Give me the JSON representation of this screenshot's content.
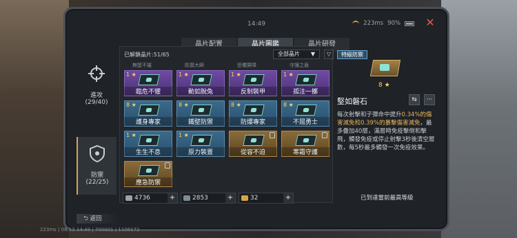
{
  "status": {
    "time": "14:49",
    "network": "223ms",
    "battery": "90%"
  },
  "tabs": [
    {
      "label": "晶片配置",
      "active": false
    },
    {
      "label": "晶片圖鑑",
      "active": true
    },
    {
      "label": "晶片研發",
      "active": false
    }
  ],
  "sidebar": {
    "attack": {
      "label": "進攻",
      "count": "(29/40)"
    },
    "defense": {
      "label": "防禦",
      "count": "(22/25)"
    }
  },
  "collection": {
    "unlocked": "已解鎖晶片:51/65",
    "filter": "全部晶片",
    "top_row": [
      "無堅不摧",
      "防禦大師",
      "恐懼屏障",
      "守護之盾"
    ],
    "cards": [
      {
        "level": "1",
        "name": "臨危不懼",
        "color": "purple",
        "locked": false
      },
      {
        "level": "1",
        "name": "動如脫兔",
        "color": "purple",
        "locked": false
      },
      {
        "level": "1",
        "name": "反制裝甲",
        "color": "purple",
        "locked": false
      },
      {
        "level": "1",
        "name": "孤注一擲",
        "color": "purple",
        "locked": false
      },
      {
        "level": "8",
        "name": "護身專家",
        "color": "blue",
        "locked": false
      },
      {
        "level": "8",
        "name": "鐵壁防禦",
        "color": "blue",
        "locked": false
      },
      {
        "level": "8",
        "name": "防爆專家",
        "color": "blue",
        "locked": false
      },
      {
        "level": "8",
        "name": "不屈勇士",
        "color": "blue",
        "locked": false
      },
      {
        "level": "1",
        "name": "生生不息",
        "color": "blue",
        "locked": false
      },
      {
        "level": "1",
        "name": "原力裝置",
        "color": "blue",
        "locked": false
      },
      {
        "level": "",
        "name": "從容不迫",
        "color": "gold",
        "locked": true
      },
      {
        "level": "",
        "name": "寒霜守護",
        "color": "gold",
        "locked": true
      },
      {
        "level": "",
        "name": "應急防禦",
        "color": "gold",
        "locked": true
      }
    ]
  },
  "resources": [
    {
      "value": "4736",
      "color": "#9aa3ab"
    },
    {
      "value": "2853",
      "color": "#7e8a95"
    },
    {
      "value": "32",
      "color": "#d7a34a"
    }
  ],
  "detail": {
    "badge": "特級防禦",
    "level": "8",
    "name": "堅如磐石",
    "desc_1": "每次射擊和子彈命中提升",
    "desc_2": "0.34%的傷害減免和0.39%的暴擊傷害減免",
    "desc_3": "，最多疊加40層，滿層時免疫擊倒和擊飛，觸發免疫或停止射擊3秒後清空層數，每5秒最多觸發一次免疫效果。",
    "maxed": "已到達當前最高等級"
  },
  "back": "返回",
  "footer": "223ms | 08.12 14:49 | 700001 | 1108172"
}
